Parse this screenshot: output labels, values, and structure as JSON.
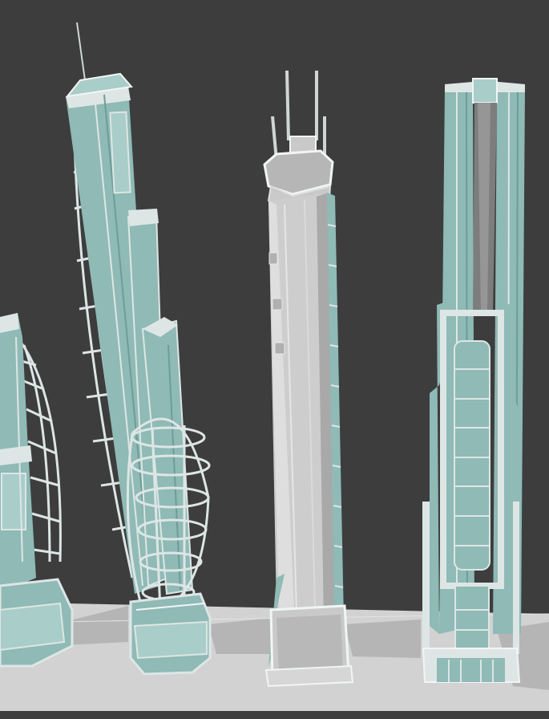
{
  "viewport": {
    "background": "#3d3d3d",
    "floor_color": "#d2d2d2",
    "shadow_color": "#b2b2b2"
  },
  "palette": {
    "teal": "#8fbab6",
    "teal_light": "#a9cdc9",
    "teal_dark": "#6e9d99",
    "trim": "#dde6e5",
    "edge": "#f2f5f5",
    "grey_tower": "#c9c9c9",
    "grey_tower_light": "#dedede",
    "grey_tower_dark": "#a6a6a6",
    "dark_inset": "#5c5c5c"
  },
  "models": [
    {
      "name": "partial-caged-tower",
      "material": "teal"
    },
    {
      "name": "leaning-caged-tower",
      "material": "teal",
      "has_antenna": true
    },
    {
      "name": "octagonal-spire-tower",
      "material": "grey",
      "antenna_count": 4
    },
    {
      "name": "twin-column-tower",
      "material": "teal",
      "has_frame_core": true
    }
  ]
}
